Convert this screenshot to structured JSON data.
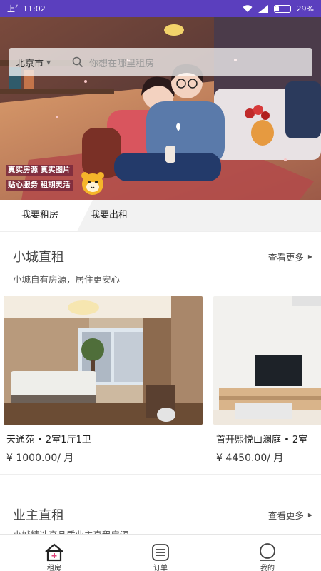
{
  "status_bar": {
    "time": "上午11:02",
    "battery": "29%",
    "battery_level": 0.29
  },
  "search": {
    "city": "北京市",
    "placeholder": "你想在哪里租房"
  },
  "hero": {
    "badge_line1": "真实房源 真实图片",
    "badge_line2": "贴心服务 租期灵活"
  },
  "tabs": [
    {
      "label": "我要租房",
      "active": true
    },
    {
      "label": "我要出租",
      "active": false
    }
  ],
  "sections": [
    {
      "title": "小城直租",
      "subtitle": "小城自有房源，居住更安心",
      "more_label": "查看更多",
      "listings": [
        {
          "name": "天通苑 • 2室1厅1卫",
          "price": "¥ 1000.00/ 月"
        },
        {
          "name": "首开熙悦山澜庭 • 2室",
          "price": "¥ 4450.00/ 月"
        }
      ]
    },
    {
      "title": "业主直租",
      "subtitle": "小城精选高品质业主直租房源",
      "more_label": "查看更多"
    }
  ],
  "bottom_nav": [
    {
      "label": "租房",
      "icon": "house-icon",
      "active": true
    },
    {
      "label": "订单",
      "icon": "order-list-icon",
      "active": false
    },
    {
      "label": "我的",
      "icon": "profile-icon",
      "active": false
    }
  ],
  "colors": {
    "status_bar": "#5b3fbe",
    "text": "#333333"
  }
}
